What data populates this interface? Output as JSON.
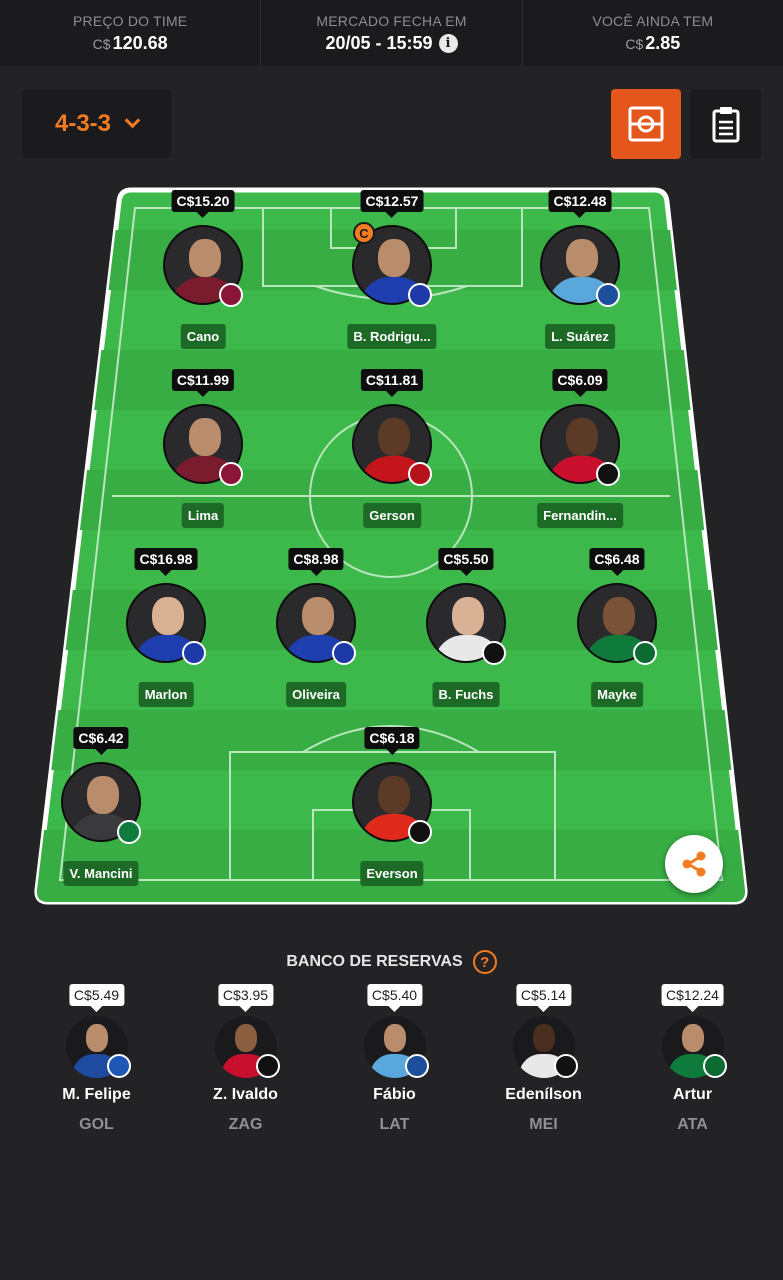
{
  "header": {
    "team_price_label": "PREÇO DO TIME",
    "team_price_currency": "C$",
    "team_price_value": "120.68",
    "market_label": "MERCADO FECHA EM",
    "market_value": "20/05 - 15:59",
    "balance_label": "VOCÊ AINDA TEM",
    "balance_currency": "C$",
    "balance_value": "2.85"
  },
  "formation": "4-3-3",
  "colors": {
    "accent": "#f47c20",
    "pitch": "#3db84a",
    "pitch_dark": "#35a843"
  },
  "players": [
    {
      "price": "C$15.20",
      "name": "Cano",
      "shirt": "#7a1c2e",
      "crest": "#8a1538"
    },
    {
      "price": "C$12.57",
      "name": "B. Rodrigu...",
      "shirt": "#1f3fb0",
      "crest": "#1e3aa8",
      "captain": "C"
    },
    {
      "price": "C$12.48",
      "name": "L. Suárez",
      "shirt": "#5aa7dc",
      "crest": "#1b4f9c"
    },
    {
      "price": "C$11.99",
      "name": "Lima",
      "shirt": "#7a1c2e",
      "crest": "#8a1538"
    },
    {
      "price": "C$11.81",
      "name": "Gerson",
      "shirt": "#c4151c",
      "crest": "#b5121b"
    },
    {
      "price": "C$6.09",
      "name": "Fernandin...",
      "shirt": "#c8102e",
      "crest": "#111111"
    },
    {
      "price": "C$16.98",
      "name": "Marlon",
      "shirt": "#1f3fb0",
      "crest": "#1e3aa8"
    },
    {
      "price": "C$8.98",
      "name": "Oliveira",
      "shirt": "#1f3fb0",
      "crest": "#1e3aa8"
    },
    {
      "price": "C$5.50",
      "name": "B. Fuchs",
      "shirt": "#e8e8e8",
      "crest": "#111111"
    },
    {
      "price": "C$6.48",
      "name": "Mayke",
      "shirt": "#0e7a3c",
      "crest": "#0b6b33"
    },
    {
      "price": "C$6.42",
      "name": "V. Mancini",
      "shirt": "#3a3a3c",
      "crest": "#0d7a3e"
    },
    {
      "price": "C$6.18",
      "name": "Everson",
      "shirt": "#e02a1c",
      "crest": "#111111"
    }
  ],
  "bench": {
    "title": "BANCO DE RESERVAS",
    "help_icon": "?",
    "items": [
      {
        "price": "C$5.49",
        "name": "M. Felipe",
        "position": "GOL",
        "shirt": "#1e4aa0",
        "crest": "#1e57b4"
      },
      {
        "price": "C$3.95",
        "name": "Z. Ivaldo",
        "position": "ZAG",
        "shirt": "#c8102e",
        "crest": "#111111"
      },
      {
        "price": "C$5.40",
        "name": "Fábio",
        "position": "LAT",
        "shirt": "#5aa7dc",
        "crest": "#1b4f9c"
      },
      {
        "price": "C$5.14",
        "name": "Edenílson",
        "position": "MEI",
        "shirt": "#e8e8e8",
        "crest": "#111111"
      },
      {
        "price": "C$12.24",
        "name": "Artur",
        "position": "ATA",
        "shirt": "#0e7a3c",
        "crest": "#0b6b33"
      }
    ]
  }
}
